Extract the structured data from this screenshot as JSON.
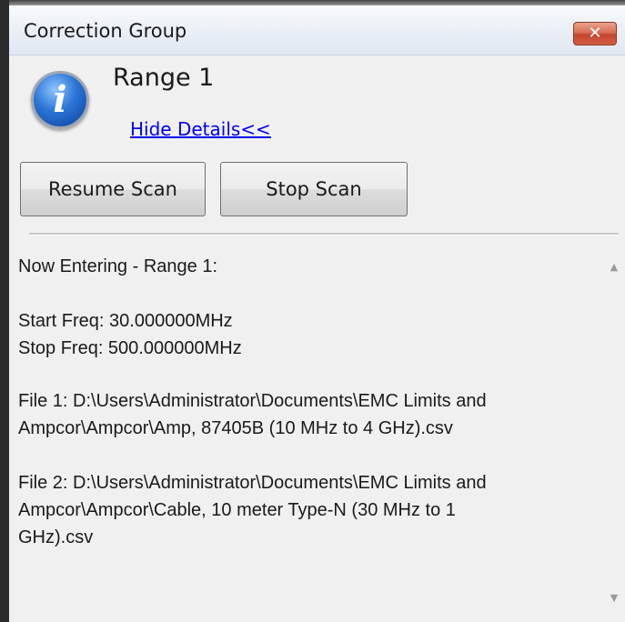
{
  "window": {
    "title": "Correction Group",
    "close_glyph": "✕"
  },
  "message": {
    "icon": "info-icon",
    "icon_glyph": "i",
    "heading": "Range 1",
    "details_link": "Hide Details<<"
  },
  "buttons": {
    "resume": "Resume Scan",
    "stop": "Stop Scan"
  },
  "log": {
    "lines": [
      "Now Entering - Range 1:",
      "Start Freq: 30.000000MHz",
      "Stop Freq: 500.000000MHz",
      "File 1: D:\\Users\\Administrator\\Documents\\EMC Limits and",
      "Ampcor\\Ampcor\\Amp, 87405B (10 MHz to 4 GHz).csv",
      "File 2: D:\\Users\\Administrator\\Documents\\EMC Limits and",
      "Ampcor\\Ampcor\\Cable, 10 meter Type-N (30 MHz to 1",
      "GHz).csv"
    ]
  },
  "scrollbar": {
    "up_glyph": "▲",
    "down_glyph": "▼"
  }
}
